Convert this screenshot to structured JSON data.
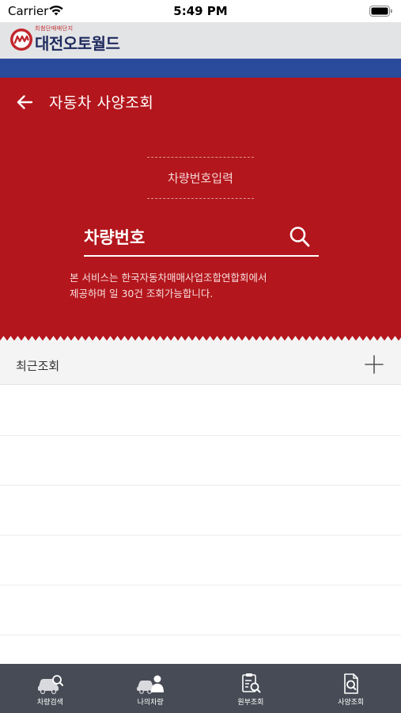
{
  "status_bar": {
    "carrier": "Carrier",
    "time": "5:49 PM"
  },
  "brand": {
    "subtitle": "최첨단매매단지",
    "name": "대전오토월드",
    "colors": {
      "brand_red": "#c1272d",
      "brand_navy": "#1e2a5e",
      "strip_blue": "#2a4a9b"
    }
  },
  "header": {
    "title": "자동차 사양조회",
    "background": "#b3161c"
  },
  "input_tab": {
    "label": "차량번호입력"
  },
  "search": {
    "placeholder": "차량번호",
    "value": ""
  },
  "notice": {
    "line1": "본 서비스는 한국자동차매매사업조합연합회에서",
    "line2": "제공하며 일 30건 조회가능합니다."
  },
  "recent": {
    "title": "최근조회",
    "add_icon": "plus-icon",
    "items": [
      "",
      "",
      "",
      "",
      ""
    ]
  },
  "tab_bar": {
    "background": "#474b55",
    "tabs": [
      {
        "label": "차량검색",
        "icon": "car-search-icon"
      },
      {
        "label": "나의차량",
        "icon": "my-car-icon"
      },
      {
        "label": "원부조회",
        "icon": "document-search-icon"
      },
      {
        "label": "사양조회",
        "icon": "spec-search-icon"
      }
    ]
  }
}
